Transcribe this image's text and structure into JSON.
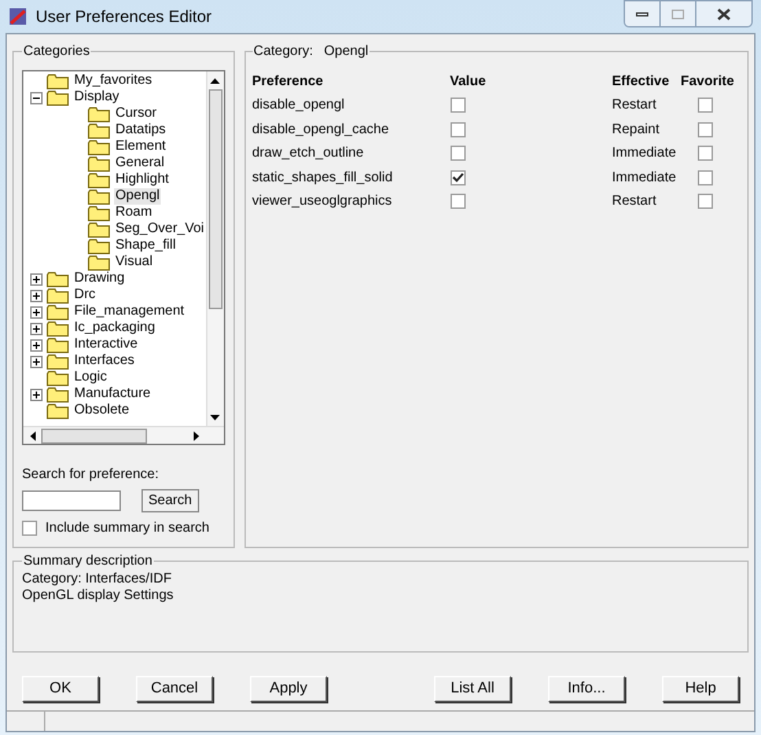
{
  "window": {
    "title": "User Preferences Editor"
  },
  "categories": {
    "title": "Categories",
    "tree": [
      {
        "label": "My_favorites",
        "selected": false
      },
      {
        "label": "Display",
        "expanded": true,
        "selected": false,
        "children": [
          {
            "label": "Cursor",
            "selected": false
          },
          {
            "label": "Datatips",
            "selected": false
          },
          {
            "label": "Element",
            "selected": false
          },
          {
            "label": "General",
            "selected": false
          },
          {
            "label": "Highlight",
            "selected": false
          },
          {
            "label": "Opengl",
            "selected": true
          },
          {
            "label": "Roam",
            "selected": false
          },
          {
            "label": "Seg_Over_Voi",
            "selected": false
          },
          {
            "label": "Shape_fill",
            "selected": false
          },
          {
            "label": "Visual",
            "selected": false
          }
        ]
      },
      {
        "label": "Drawing",
        "expanded": false,
        "selected": false
      },
      {
        "label": "Drc",
        "expanded": false,
        "selected": false
      },
      {
        "label": "File_management",
        "expanded": false,
        "selected": false
      },
      {
        "label": "Ic_packaging",
        "expanded": false,
        "selected": false
      },
      {
        "label": "Interactive",
        "expanded": false,
        "selected": false
      },
      {
        "label": "Interfaces",
        "expanded": false,
        "selected": false
      },
      {
        "label": "Logic",
        "selected": false
      },
      {
        "label": "Manufacture",
        "expanded": false,
        "selected": false
      },
      {
        "label": "Obsolete",
        "selected": false
      }
    ],
    "search_label": "Search for preference:",
    "search_button": "Search",
    "include_summary": {
      "label": "Include summary in search",
      "checked": false
    }
  },
  "category": {
    "title_label": "Category:",
    "title_value": "Opengl",
    "columns": [
      "Preference",
      "Value",
      "Effective",
      "Favorite"
    ],
    "rows": [
      {
        "preference": "disable_opengl",
        "value": false,
        "effective": "Restart",
        "favorite": false
      },
      {
        "preference": "disable_opengl_cache",
        "value": false,
        "effective": "Repaint",
        "favorite": false
      },
      {
        "preference": "draw_etch_outline",
        "value": false,
        "effective": "Immediate",
        "favorite": false
      },
      {
        "preference": "static_shapes_fill_solid",
        "value": true,
        "effective": "Immediate",
        "favorite": false
      },
      {
        "preference": "viewer_useoglgraphics",
        "value": false,
        "effective": "Restart",
        "favorite": false
      }
    ]
  },
  "summary": {
    "title": "Summary description",
    "lines": [
      "Category: Interfaces/IDF",
      "OpenGL display Settings"
    ]
  },
  "buttons": [
    "OK",
    "Cancel",
    "Apply",
    "List All",
    "Info...",
    "Help"
  ]
}
